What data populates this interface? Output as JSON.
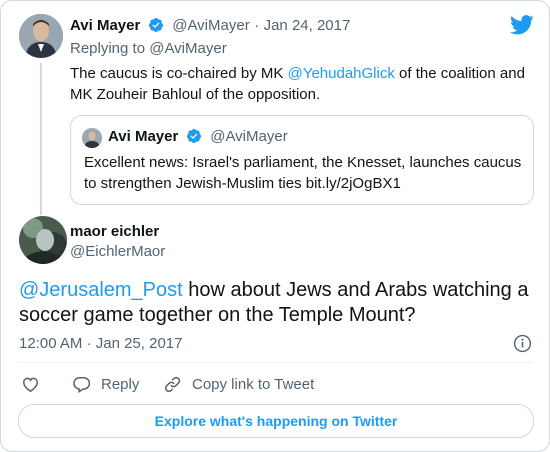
{
  "colors": {
    "accent": "#1d9bf0",
    "muted": "#536471",
    "text": "#0f1419",
    "border": "#cfd9de"
  },
  "parent_tweet": {
    "author_name": "Avi Mayer",
    "author_handle": "@AviMayer",
    "date": "Jan 24, 2017",
    "replying_to_label": "Replying to",
    "replying_to_handle": "@AviMayer",
    "text_1": "The caucus is co-chaired by MK ",
    "mention": "@YehudahGlick",
    "text_2": " of the coalition and MK Zouheir Bahloul of the opposition.",
    "quoted": {
      "author_name": "Avi Mayer",
      "author_handle": "@AviMayer",
      "text": "Excellent news: Israel's parliament, the Knesset, launches caucus to strengthen Jewish-Muslim ties bit.ly/2jOgBX1"
    }
  },
  "main_tweet": {
    "author_name": "maor eichler",
    "author_handle": "@EichlerMaor",
    "mention": "@Jerusalem_Post",
    "text": " how about Jews and Arabs watching a soccer game together on the Temple Mount?",
    "time": "12:00 AM",
    "date": "Jan 25, 2017"
  },
  "actions": {
    "like_icon": "heart-icon",
    "reply_label": "Reply",
    "copy_link_label": "Copy link to Tweet"
  },
  "explore_label": "Explore what's happening on Twitter",
  "separator": "·"
}
